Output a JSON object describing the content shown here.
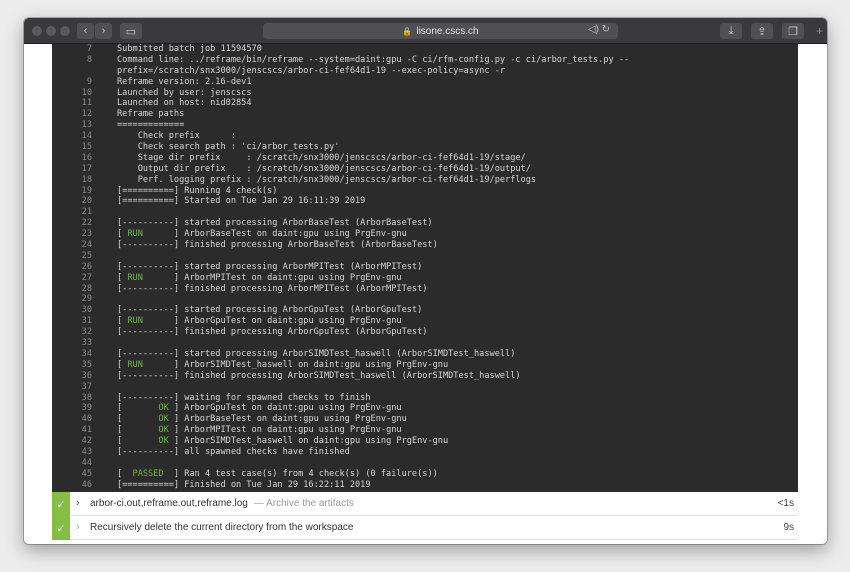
{
  "browser": {
    "url": "lisone.cscs.ch",
    "buttons": {
      "back": "‹",
      "forward": "›",
      "sidebar": "▭",
      "download": "⤓",
      "share": "⇪",
      "tabs": "❐",
      "new_tab": "+"
    },
    "url_right": "◁) ↻"
  },
  "console": {
    "lines": [
      {
        "n": "7",
        "t": "Submitted batch job 11594570"
      },
      {
        "n": "8",
        "t": "Command line: ../reframe/bin/reframe --system=daint:gpu -C ci/rfm-config.py -c ci/arbor_tests.py --"
      },
      {
        "n": "",
        "t": "prefix=/scratch/snx3000/jenscscs/arbor-ci-fef64d1-19 --exec-policy=async -r"
      },
      {
        "n": "9",
        "t": "Reframe version: 2.16-dev1"
      },
      {
        "n": "10",
        "t": "Launched by user: jenscscs"
      },
      {
        "n": "11",
        "t": "Launched on host: nid02854"
      },
      {
        "n": "12",
        "t": "Reframe paths"
      },
      {
        "n": "13",
        "t": "============="
      },
      {
        "n": "14",
        "t": "    Check prefix      :"
      },
      {
        "n": "15",
        "t": "    Check search path : 'ci/arbor_tests.py'"
      },
      {
        "n": "16",
        "t": "    Stage dir prefix     : /scratch/snx3000/jenscscs/arbor-ci-fef64d1-19/stage/"
      },
      {
        "n": "17",
        "t": "    Output dir prefix    : /scratch/snx3000/jenscscs/arbor-ci-fef64d1-19/output/"
      },
      {
        "n": "18",
        "t": "    Perf. logging prefix : /scratch/snx3000/jenscscs/arbor-ci-fef64d1-19/perflogs"
      },
      {
        "n": "19",
        "t": "[==========] Running 4 check(s)"
      },
      {
        "n": "20",
        "t": "[==========] Started on Tue Jan 29 16:11:39 2019"
      },
      {
        "n": "21",
        "t": ""
      },
      {
        "n": "22",
        "t": "[----------] started processing ArborBaseTest (ArborBaseTest)"
      },
      {
        "n": "23",
        "t": "[ ",
        "g": "RUN",
        "r": "      ] ArborBaseTest on daint:gpu using PrgEnv-gnu"
      },
      {
        "n": "24",
        "t": "[----------] finished processing ArborBaseTest (ArborBaseTest)"
      },
      {
        "n": "25",
        "t": ""
      },
      {
        "n": "26",
        "t": "[----------] started processing ArborMPITest (ArborMPITest)"
      },
      {
        "n": "27",
        "t": "[ ",
        "g": "RUN",
        "r": "      ] ArborMPITest on daint:gpu using PrgEnv-gnu"
      },
      {
        "n": "28",
        "t": "[----------] finished processing ArborMPITest (ArborMPITest)"
      },
      {
        "n": "29",
        "t": ""
      },
      {
        "n": "30",
        "t": "[----------] started processing ArborGpuTest (ArborGpuTest)"
      },
      {
        "n": "31",
        "t": "[ ",
        "g": "RUN",
        "r": "      ] ArborGpuTest on daint:gpu using PrgEnv-gnu"
      },
      {
        "n": "32",
        "t": "[----------] finished processing ArborGpuTest (ArborGpuTest)"
      },
      {
        "n": "33",
        "t": ""
      },
      {
        "n": "34",
        "t": "[----------] started processing ArborSIMDTest_haswell (ArborSIMDTest_haswell)"
      },
      {
        "n": "35",
        "t": "[ ",
        "g": "RUN",
        "r": "      ] ArborSIMDTest_haswell on daint:gpu using PrgEnv-gnu"
      },
      {
        "n": "36",
        "t": "[----------] finished processing ArborSIMDTest_haswell (ArborSIMDTest_haswell)"
      },
      {
        "n": "37",
        "t": ""
      },
      {
        "n": "38",
        "t": "[----------] waiting for spawned checks to finish"
      },
      {
        "n": "39",
        "t": "[       ",
        "g": "OK",
        "r": " ] ArborGpuTest on daint:gpu using PrgEnv-gnu"
      },
      {
        "n": "40",
        "t": "[       ",
        "g": "OK",
        "r": " ] ArborBaseTest on daint:gpu using PrgEnv-gnu"
      },
      {
        "n": "41",
        "t": "[       ",
        "g": "OK",
        "r": " ] ArborMPITest on daint:gpu using PrgEnv-gnu"
      },
      {
        "n": "42",
        "t": "[       ",
        "g": "OK",
        "r": " ] ArborSIMDTest_haswell on daint:gpu using PrgEnv-gnu"
      },
      {
        "n": "43",
        "t": "[----------] all spawned checks have finished"
      },
      {
        "n": "44",
        "t": ""
      },
      {
        "n": "45",
        "t": "[  ",
        "g": "PASSED",
        "r": "  ] Ran 4 test case(s) from 4 check(s) (0 failure(s))"
      },
      {
        "n": "46",
        "t": "[==========] Finished on Tue Jan 29 16:22:11 2019"
      }
    ]
  },
  "steps": [
    {
      "check": "✓",
      "chev": "›",
      "title": "arbor-ci.out,reframe.out,reframe.log",
      "desc": "— Archive the artifacts",
      "time": "<1s"
    },
    {
      "check": "✓",
      "chev": "›",
      "title": "Recursively delete the current directory from the workspace",
      "desc": "",
      "time": "9s"
    }
  ],
  "colors": {
    "ok_green": "#72b54a",
    "step_green": "#84be45",
    "console_bg": "#2b2b2b"
  }
}
